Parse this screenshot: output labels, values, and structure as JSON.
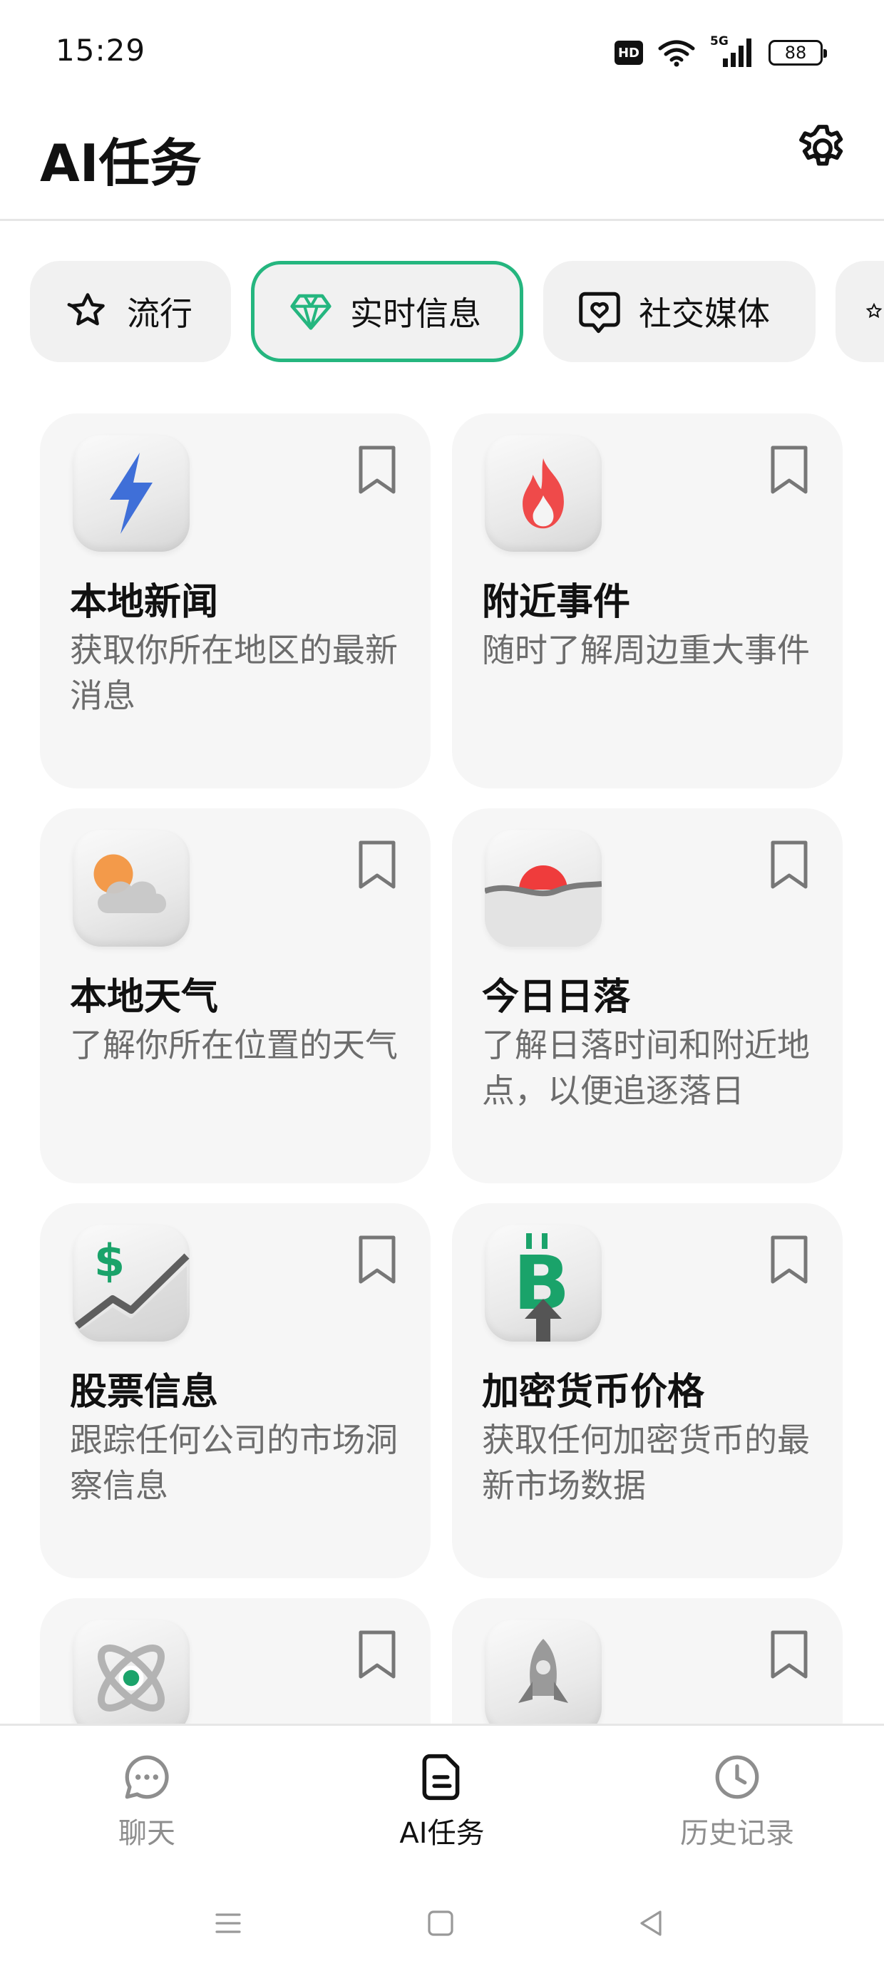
{
  "status_bar": {
    "time": "15:29",
    "hd": "HD",
    "network": "5G",
    "battery": "88"
  },
  "header": {
    "title": "AI任务",
    "settings_icon": "gear-icon"
  },
  "tabs": [
    {
      "label": "流行",
      "icon": "sparkle-star-icon",
      "active": false
    },
    {
      "label": "实时信息",
      "icon": "diamond-icon",
      "active": true
    },
    {
      "label": "社交媒体",
      "icon": "heart-message-icon",
      "active": false
    }
  ],
  "cards": [
    {
      "title": "本地新闻",
      "desc": "获取你所在地区的最新消息",
      "icon": "lightning-icon"
    },
    {
      "title": "附近事件",
      "desc": "随时了解周边重大事件",
      "icon": "flame-icon"
    },
    {
      "title": "本地天气",
      "desc": "了解你所在位置的天气",
      "icon": "weather-cloud-sun-icon"
    },
    {
      "title": "今日日落",
      "desc": "了解日落时间和附近地点，以便追逐落日",
      "icon": "sunset-icon"
    },
    {
      "title": "股票信息",
      "desc": "跟踪任何公司的市场洞察信息",
      "icon": "stock-chart-icon"
    },
    {
      "title": "加密货币价格",
      "desc": "获取任何加密货币的最新市场数据",
      "icon": "bitcoin-icon"
    },
    {
      "title": "",
      "desc": "",
      "icon": "atom-icon"
    },
    {
      "title": "",
      "desc": "",
      "icon": "rocket-icon"
    }
  ],
  "bottom_nav": [
    {
      "label": "聊天",
      "icon": "chat-bubble-icon",
      "active": false
    },
    {
      "label": "AI任务",
      "icon": "document-icon",
      "active": true
    },
    {
      "label": "历史记录",
      "icon": "clock-icon",
      "active": false
    }
  ],
  "colors": {
    "accent": "#25b67f",
    "text_primary": "#111111",
    "text_secondary": "#6c6c6c",
    "card_bg": "#f6f6f6",
    "lightning_blue": "#3f6fd8",
    "flame_red": "#ef4a4a",
    "dollar_green": "#1aa36a"
  }
}
